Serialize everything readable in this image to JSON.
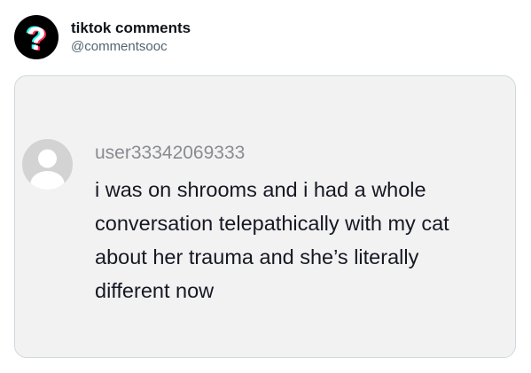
{
  "tweet": {
    "display_name": "tiktok comments",
    "handle": "@commentsooc",
    "avatar_icon": "question-mark-icon"
  },
  "comment": {
    "username": "user33342069333",
    "avatar_icon": "default-user-icon",
    "text_lines": [
      "i was on shrooms and i had a whole",
      "conversation telepathically with my cat",
      "about her trauma and she’s literally",
      "different now"
    ]
  },
  "colors": {
    "card_background": "#f2f2f2",
    "username_gray": "#8a8b91",
    "avatar_cyan": "#25f4ee",
    "avatar_pink": "#fe2c55"
  }
}
